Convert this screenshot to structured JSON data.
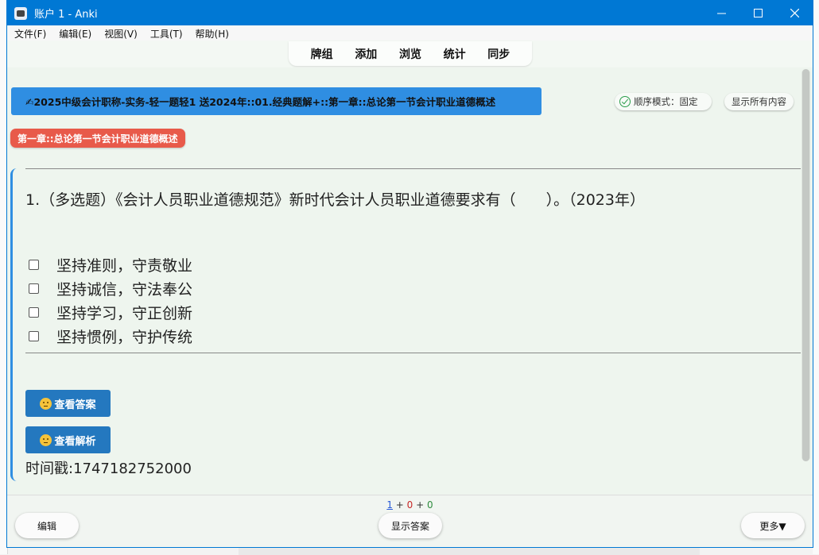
{
  "window": {
    "title": "账户 1 - Anki"
  },
  "menu": [
    "文件(F)",
    "编辑(E)",
    "视图(V)",
    "工具(T)",
    "帮助(H)"
  ],
  "toolbar": [
    "牌组",
    "添加",
    "浏览",
    "统计",
    "同步"
  ],
  "deck": {
    "path": "✍2025中级会计职称-实务-轻一题轻1 送2024年::01.经典题解+::第一章::总论第一节会计职业道德概述"
  },
  "mode": {
    "label": "顺序模式：固定"
  },
  "show_all": "显示所有内容",
  "chapter_tag": "第一章::总论第一节会计职业道德概述",
  "question": "1.（多选题）《会计人员职业道德规范》新时代会计人员职业道德要求有（　　）。（2023年）",
  "options": [
    "坚持准则，守责敬业",
    "坚持诚信，守法奉公",
    "坚持学习，守正创新",
    "坚持惯例，守护传统"
  ],
  "buttons": {
    "view_answer": "查看答案",
    "view_analysis": "查看解析"
  },
  "timestamp": "时间戳:1747182752000",
  "counts": {
    "new": "1",
    "plus1": " + ",
    "learn": "0",
    "plus2": " + ",
    "review": "0"
  },
  "bottom": {
    "edit": "编辑",
    "show_answer": "显示答案",
    "more": "更多▼"
  },
  "colors": {
    "titlebar": "#0078d4",
    "banner": "#2f8ee2",
    "tag": "#e85a4a",
    "button": "#2478bf",
    "background": "#eef5ee"
  }
}
